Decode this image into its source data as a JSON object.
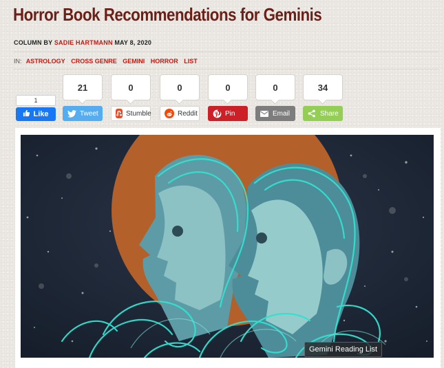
{
  "article": {
    "title": "Horror Book Recommendations for Geminis",
    "byline_prefix": "COLUMN BY",
    "author": "SADIE HARTMANN",
    "date": "MAY 8, 2020",
    "in_label": "IN:",
    "categories": [
      "ASTROLOGY",
      "CROSS GENRE",
      "GEMINI",
      "HORROR",
      "LIST"
    ]
  },
  "facebook": {
    "count": "1",
    "label": "Like",
    "color": "#1877f2"
  },
  "share_buttons": [
    {
      "count": "21",
      "label": "Tweet",
      "icon": "twitter-icon",
      "color": "#55acee"
    },
    {
      "count": "0",
      "label": "Stumble",
      "icon": "stumbleupon-icon",
      "color": "#eb4924"
    },
    {
      "count": "0",
      "label": "Reddit",
      "icon": "reddit-icon",
      "color": "#ff4500"
    },
    {
      "count": "0",
      "label": "Pin",
      "icon": "pinterest-icon",
      "color": "#cb2027"
    },
    {
      "count": "0",
      "label": "Email",
      "icon": "email-icon",
      "color": "#7d7d7d"
    },
    {
      "count": "34",
      "label": "Share",
      "icon": "share-icon",
      "color": "#94ce54"
    }
  ],
  "image": {
    "caption": "Gemini Reading List"
  },
  "colors": {
    "title": "#6a1f17",
    "link": "#c2190f",
    "background": "#ebe8e3"
  }
}
